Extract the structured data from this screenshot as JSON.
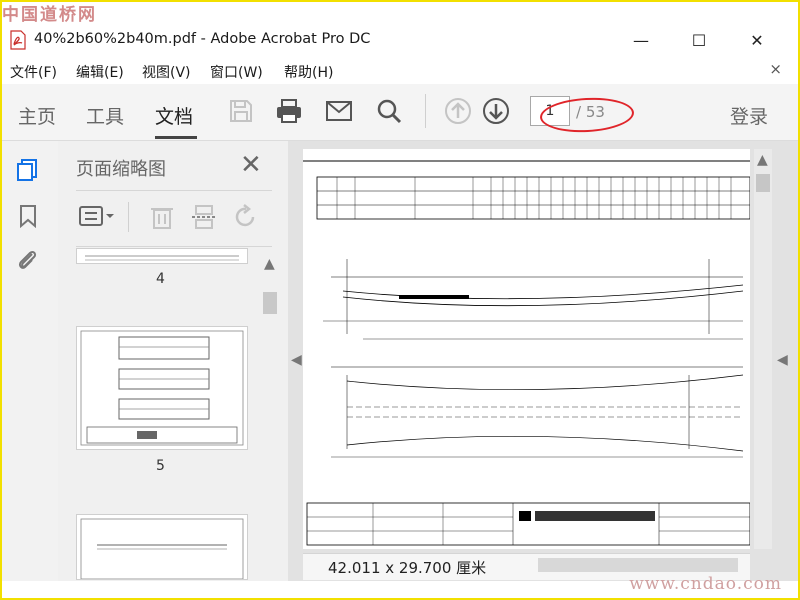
{
  "watermark": {
    "top_left": "中国道桥网",
    "bottom_right": "www.cndao.com"
  },
  "window": {
    "title": "40%2b60%2b40m.pdf - Adobe Acrobat Pro DC",
    "controls": {
      "minimize": "—",
      "maximize": "☐",
      "close": "✕"
    }
  },
  "menu": {
    "items": [
      {
        "label": "文件(F)"
      },
      {
        "label": "编辑(E)"
      },
      {
        "label": "视图(V)"
      },
      {
        "label": "窗口(W)"
      },
      {
        "label": "帮助(H)"
      }
    ],
    "close": "×"
  },
  "toolbar": {
    "tabs": [
      {
        "label": "主页"
      },
      {
        "label": "工具"
      },
      {
        "label": "文档"
      }
    ],
    "active_tab": "文档",
    "page_current": "1",
    "page_total": "/ 53",
    "login": "登录",
    "icons": [
      "save-icon",
      "print-icon",
      "mail-icon",
      "search-icon",
      "page-up-icon",
      "page-down-icon"
    ]
  },
  "sidebar": {
    "icons": [
      "pages-icon",
      "bookmark-icon",
      "attachment-icon"
    ]
  },
  "thumbnails": {
    "title": "页面缩略图",
    "close": "✕",
    "pages": [
      {
        "number": "4"
      },
      {
        "number": "5"
      }
    ]
  },
  "document": {
    "dimensions": "42.011 x 29.700 厘米"
  },
  "colors": {
    "accent": "#1473e6",
    "annotation": "#e0252a",
    "frame": "#f2e000"
  }
}
